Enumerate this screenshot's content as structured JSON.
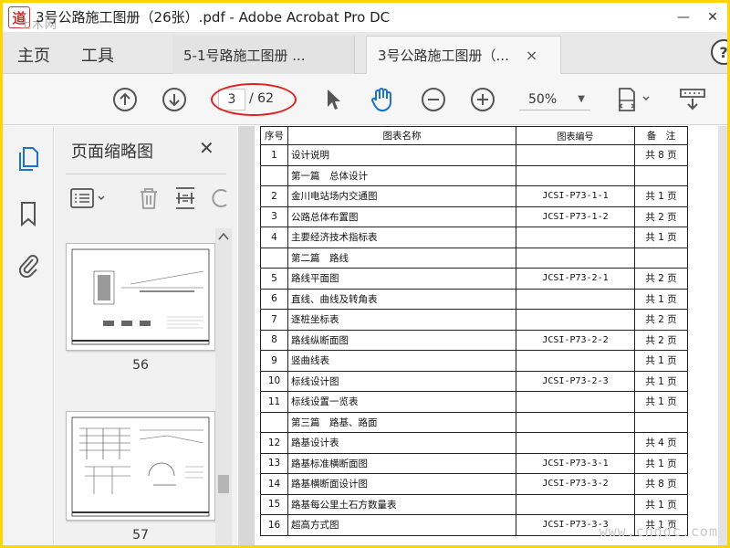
{
  "window": {
    "title": "3号公路施工图册（26张）.pdf - Adobe Acrobat Pro DC",
    "logo_char": "道",
    "watermark_top": "土木网",
    "minimize": "—",
    "close": "✕"
  },
  "tabs": {
    "home": "主页",
    "tools": "工具",
    "docs": [
      {
        "label": "5-1号路施工图册 ..."
      },
      {
        "label": "3号公路施工图册（...",
        "close": "×"
      }
    ],
    "help": "?"
  },
  "toolbar": {
    "current_page": "3",
    "total_pages": "/ 62",
    "zoom": "50%",
    "zoom_caret": "▼"
  },
  "thumbnails_panel": {
    "title": "页面缩略图",
    "close": "✕",
    "pages": [
      {
        "label": "56"
      },
      {
        "label": "57"
      }
    ]
  },
  "table": {
    "headers": [
      "序号",
      "图表名称",
      "图表编号",
      "备　注"
    ],
    "rows": [
      [
        "1",
        "设计说明",
        "",
        "共 8 页"
      ],
      [
        "",
        "第一篇　总体设计",
        "",
        ""
      ],
      [
        "2",
        "金川电站场内交通图",
        "JCSI-P73-1-1",
        "共 1 页"
      ],
      [
        "3",
        "公路总体布置图",
        "JCSI-P73-1-2",
        "共 2 页"
      ],
      [
        "4",
        "主要经济技术指标表",
        "",
        "共 1 页"
      ],
      [
        "",
        "第二篇　路线",
        "",
        ""
      ],
      [
        "5",
        "路线平面图",
        "JCSI-P73-2-1",
        "共 2 页"
      ],
      [
        "6",
        "直线、曲线及转角表",
        "",
        "共 1 页"
      ],
      [
        "7",
        "逐桩坐标表",
        "",
        "共 2 页"
      ],
      [
        "8",
        "路线纵断面图",
        "JCSI-P73-2-2",
        "共 2 页"
      ],
      [
        "9",
        "竖曲线表",
        "",
        "共 1 页"
      ],
      [
        "10",
        "标线设计图",
        "JCSI-P73-2-3",
        "共 1 页"
      ],
      [
        "11",
        "标线设置一览表",
        "",
        "共 1 页"
      ],
      [
        "",
        "第三篇　路基、路面",
        "",
        ""
      ],
      [
        "12",
        "路基设计表",
        "",
        "共 4 页"
      ],
      [
        "13",
        "路基标准横断面图",
        "JCSI-P73-3-1",
        "共 1 页"
      ],
      [
        "14",
        "路基横断面设计图",
        "JCSI-P73-3-2",
        "共 8 页"
      ],
      [
        "15",
        "路基每公里土石方数量表",
        "",
        "共 1 页"
      ],
      [
        "16",
        "超高方式图",
        "JCSI-P73-3-3",
        "共 1 页"
      ]
    ]
  },
  "watermark_br": "www.cnddc.com",
  "colors": {
    "frame": "#ffd400",
    "accent_blue": "#1a73c8",
    "annotation_red": "#e02020"
  }
}
